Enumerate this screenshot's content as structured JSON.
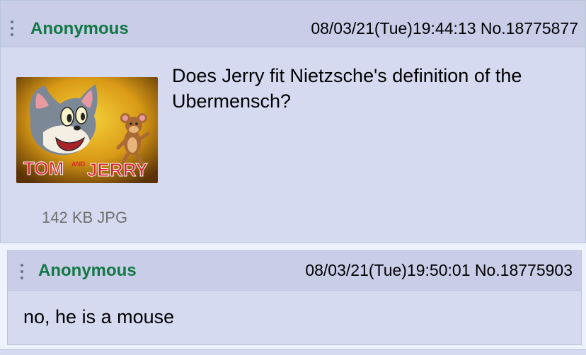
{
  "op": {
    "name": "Anonymous",
    "info": "08/03/21(Tue)19:44:13 No.18775877",
    "comment": "Does Jerry fit Nietzsche's definition of the Ubermensch?",
    "file_info": "142 KB JPG",
    "thumbnail": {
      "logo_text_left": "TOM",
      "logo_text_mid": "AND",
      "logo_text_right": "JERRY"
    }
  },
  "reply": {
    "name": "Anonymous",
    "info": "08/03/21(Tue)19:50:01 No.18775903",
    "comment": "no, he is a mouse"
  },
  "colors": {
    "post_bg": "#d6daf0",
    "header_bg": "#c9cde8",
    "border": "#b7c5d9",
    "name": "#117743",
    "file_info": "#707070"
  }
}
